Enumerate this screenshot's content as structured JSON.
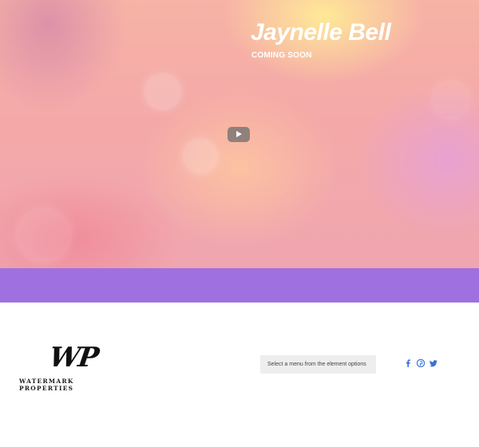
{
  "hero": {
    "title": "Jaynelle Bell",
    "subtitle": "COMING SOON",
    "video_play_icon": "play-icon"
  },
  "band": {
    "color": "#9f70df"
  },
  "footer": {
    "logo": {
      "mark": "WP",
      "text": "WATERMARK PROPERTIES"
    },
    "menu_placeholder": "Select a menu from the element options",
    "social_icons": [
      "facebook-icon",
      "pinterest-icon",
      "twitter-icon"
    ],
    "social_color": "#3b6fd6"
  }
}
